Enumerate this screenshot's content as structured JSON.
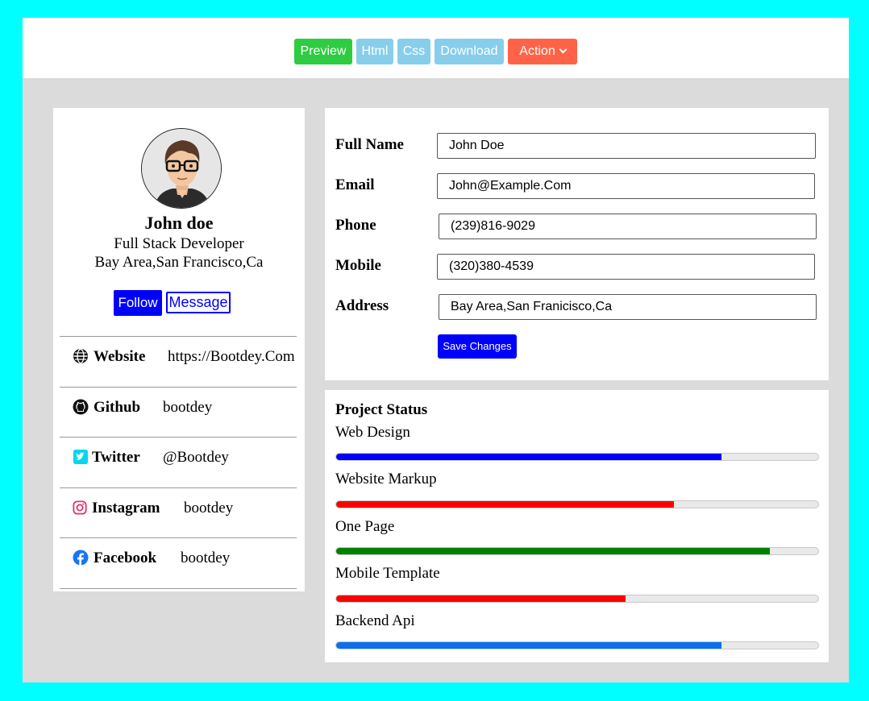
{
  "toolbar": {
    "buttons": [
      {
        "label": "Preview",
        "color": "#2ecc40"
      },
      {
        "label": "Html",
        "color": "#87ceeb"
      },
      {
        "label": "Css",
        "color": "#87ceeb"
      },
      {
        "label": "Download",
        "color": "#87ceeb"
      },
      {
        "label": "Action",
        "color": "#ff6347"
      }
    ]
  },
  "profile": {
    "name": "John doe",
    "role": "Full Stack Developer",
    "location": "Bay Area,San Francisco,Ca",
    "follow_label": "Follow",
    "message_label": "Message",
    "avatar_icon": "avatar-cartoon-icon"
  },
  "social": [
    {
      "icon": "globe-icon",
      "label": "Website",
      "value": "https://Bootdey.Com"
    },
    {
      "icon": "github-icon",
      "label": "Github",
      "value": "bootdey"
    },
    {
      "icon": "twitter-icon",
      "label": "Twitter",
      "value": "@Bootdey"
    },
    {
      "icon": "instagram-icon",
      "label": "Instagram",
      "value": "bootdey"
    },
    {
      "icon": "facebook-icon",
      "label": "Facebook",
      "value": "bootdey"
    }
  ],
  "details": {
    "fields": [
      {
        "label": "Full Name",
        "value": "John Doe"
      },
      {
        "label": "Email",
        "value": "John@Example.Com"
      },
      {
        "label": "Phone",
        "value": "(239)816-9029"
      },
      {
        "label": "Mobile",
        "value": "(320)380-4539"
      },
      {
        "label": "Address",
        "value": "Bay Area,San Franicisco,Ca"
      }
    ],
    "save_label": "Save Changes"
  },
  "project_status": {
    "title": "Project Status",
    "items": [
      {
        "label": "Web Design",
        "progress": 80,
        "color": "#0000ff"
      },
      {
        "label": "Website Markup",
        "progress": 70,
        "color": "#ff0000"
      },
      {
        "label": "One Page",
        "progress": 90,
        "color": "#008000"
      },
      {
        "label": "Mobile Template",
        "progress": 60,
        "color": "#ff0000"
      },
      {
        "label": "Backend Api",
        "progress": 80,
        "color": "#0b6ff0"
      }
    ]
  }
}
